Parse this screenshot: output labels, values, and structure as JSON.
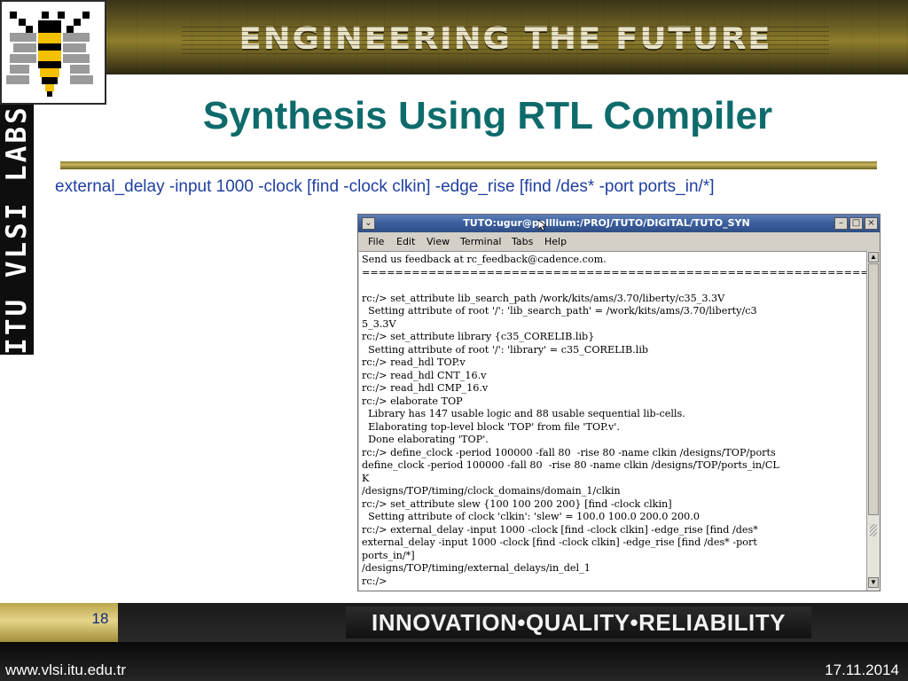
{
  "banner": {
    "title": "ENGINEERING THE FUTURE"
  },
  "sidebar": {
    "vertical_text": "ITU VLSI LABS"
  },
  "slide": {
    "title": "Synthesis Using RTL Compiler",
    "command": "external_delay -input 1000 -clock [find -clock clkin] -edge_rise [find /des* -port ports_in/*]"
  },
  "terminal": {
    "title": "TUTO:ugur@palllium:/PROJ/TUTO/DIGITAL/TUTO_SYN",
    "menu": [
      "File",
      "Edit",
      "View",
      "Terminal",
      "Tabs",
      "Help"
    ],
    "lines": [
      "Send us feedback at rc_feedback@cadence.com.",
      "==================================================================",
      "",
      "rc:/> set_attribute lib_search_path /work/kits/ams/3.70/liberty/c35_3.3V",
      "  Setting attribute of root '/': 'lib_search_path' = /work/kits/ams/3.70/liberty/c3",
      "5_3.3V",
      "rc:/> set_attribute library {c35_CORELIB.lib}",
      "  Setting attribute of root '/': 'library' = c35_CORELIB.lib",
      "rc:/> read_hdl TOP.v",
      "rc:/> read_hdl CNT_16.v",
      "rc:/> read_hdl CMP_16.v",
      "rc:/> elaborate TOP",
      "  Library has 147 usable logic and 88 usable sequential lib-cells.",
      "  Elaborating top-level block 'TOP' from file 'TOP.v'.",
      "  Done elaborating 'TOP'.",
      "rc:/> define_clock -period 100000 -fall 80  -rise 80 -name clkin /designs/TOP/ports",
      "define_clock -period 100000 -fall 80  -rise 80 -name clkin /designs/TOP/ports_in/CL",
      "K",
      "/designs/TOP/timing/clock_domains/domain_1/clkin",
      "rc:/> set_attribute slew {100 100 200 200} [find -clock clkin]",
      "  Setting attribute of clock 'clkin': 'slew' = 100.0 100.0 200.0 200.0",
      "rc:/> external_delay -input 1000 -clock [find -clock clkin] -edge_rise [find /des*",
      "external_delay -input 1000 -clock [find -clock clkin] -edge_rise [find /des* -port",
      "ports_in/*]",
      "/designs/TOP/timing/external_delays/in_del_1",
      "rc:/>"
    ]
  },
  "footer": {
    "page_number": "18",
    "tagline": "INNOVATION•QUALITY•RELIABILITY",
    "url": "www.vlsi.itu.edu.tr",
    "date": "17.11.2014"
  },
  "colors": {
    "title": "#0f6b6b",
    "command_text": "#1f3fa0",
    "banner_gold": "#8f7e2c"
  },
  "icons": {
    "logo": "bee-logo-icon",
    "window_menu": "window-menu-icon",
    "minimize": "minimize-icon",
    "maximize": "maximize-icon",
    "close": "close-icon",
    "cursor": "mouse-cursor-icon"
  }
}
